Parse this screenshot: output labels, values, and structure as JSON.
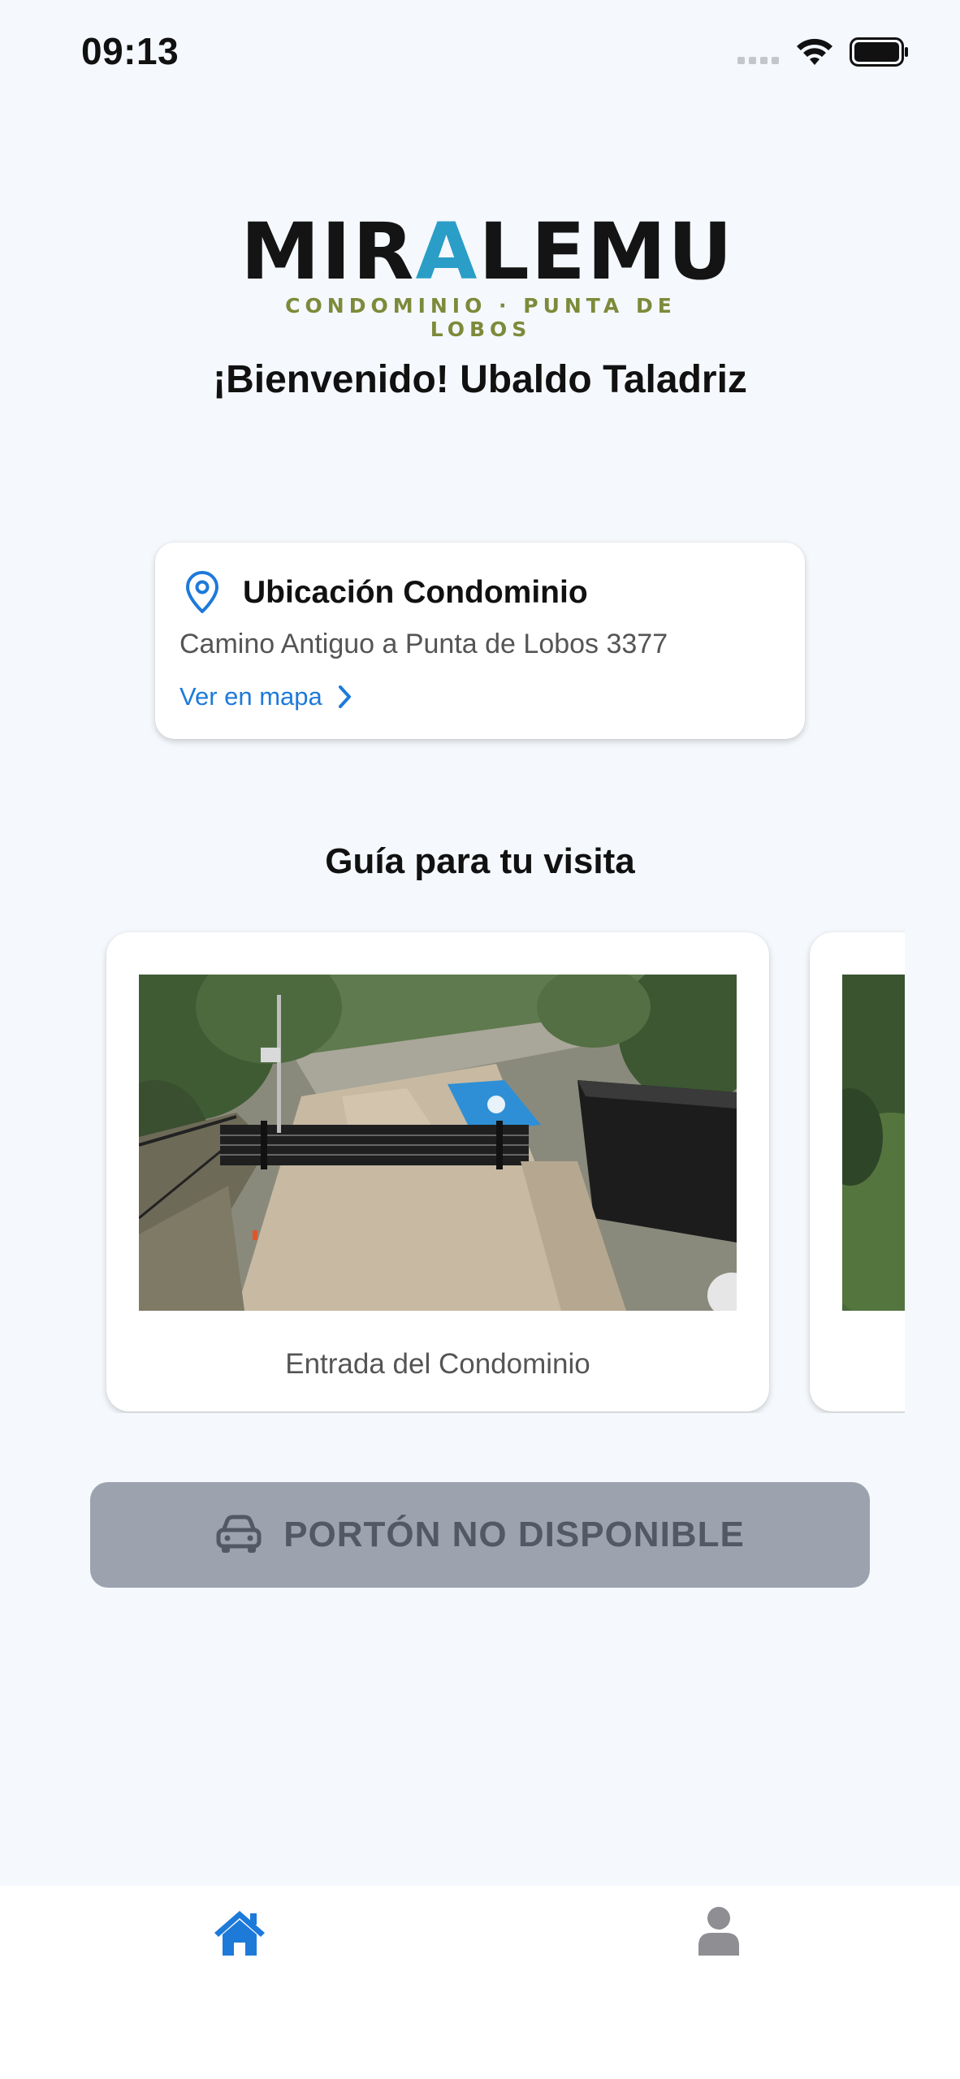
{
  "status_bar": {
    "time": "09:13",
    "icons": [
      "signal-icon",
      "wifi-icon",
      "battery-icon"
    ]
  },
  "logo": {
    "word_before_accent": "MIR",
    "word_accent": "A",
    "word_after_accent": "LEMU",
    "subtitle": "CONDOMINIO · PUNTA DE LOBOS"
  },
  "welcome_text": "¡Bienvenido! Ubaldo Taladriz",
  "location_card": {
    "icon": "location-pin-icon",
    "title": "Ubicación Condominio",
    "address": "Camino Antiguo a Punta de Lobos 3377",
    "link_label": "Ver en mapa"
  },
  "guide": {
    "title": "Guía para tu visita",
    "cards": [
      {
        "caption": "Entrada del Condominio",
        "image": "aerial photo of condominium entrance gate"
      },
      {
        "caption": "",
        "image": "aerial photo of trees (partially visible)"
      }
    ]
  },
  "gate_button": {
    "label": "PORTÓN NO DISPONIBLE",
    "icon": "car-icon"
  },
  "tab_bar": {
    "tabs": [
      {
        "name": "home",
        "icon": "home-icon",
        "active": true
      },
      {
        "name": "profile",
        "icon": "user-icon",
        "active": false
      }
    ]
  },
  "colors": {
    "background": "#f5f8fc",
    "accent_blue": "#1d7ad9",
    "logo_teal": "#2a9ec6",
    "logo_olive": "#7d8a3a",
    "disabled_button": "#9ca3af",
    "inactive_tab": "#8e8e93"
  }
}
